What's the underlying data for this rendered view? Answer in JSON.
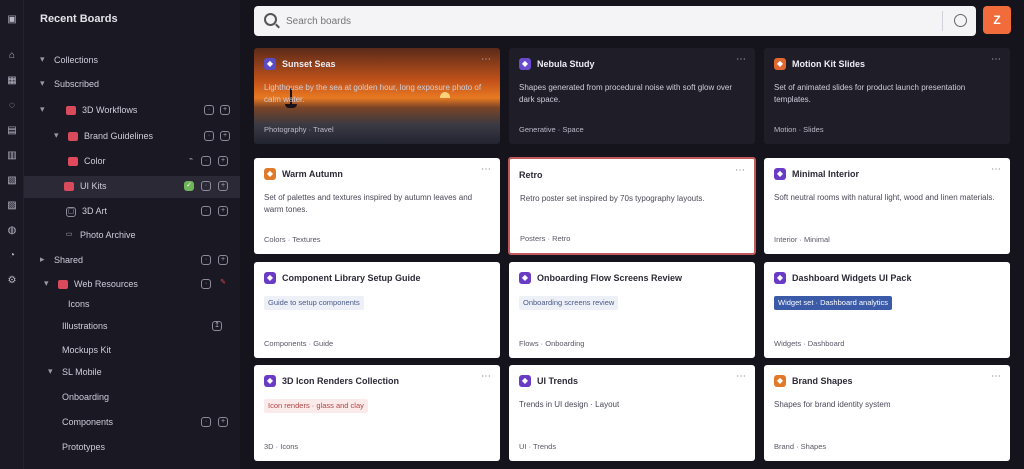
{
  "sidebar": {
    "title": "Recent Boards",
    "rows": [
      {
        "label": "Collections",
        "chev": "▾"
      },
      {
        "label": "Subscribed",
        "chev": "▾"
      },
      {
        "label": "3D Workflows",
        "chev": "▾"
      },
      {
        "label": "Brand Guidelines",
        "chev": "▾"
      },
      {
        "label": "Color",
        "chev": ""
      },
      {
        "label": "UI Kits",
        "chev": ""
      },
      {
        "label": "3D Art",
        "chev": ""
      },
      {
        "label": "Photo Archive",
        "chev": ""
      },
      {
        "label": "Shared",
        "chev": "▸"
      },
      {
        "label": "Web Resources",
        "chev": "▾"
      },
      {
        "label": "Icons",
        "chev": ""
      },
      {
        "label": "Illustrations",
        "chev": ""
      },
      {
        "label": "Mockups Kit",
        "chev": ""
      },
      {
        "label": "SL Mobile",
        "chev": "▾"
      },
      {
        "label": "Onboarding",
        "chev": ""
      },
      {
        "label": "Components",
        "chev": ""
      },
      {
        "label": "Prototypes",
        "chev": ""
      }
    ]
  },
  "search": {
    "placeholder": "Search boards"
  },
  "profile": {
    "label": "Z"
  },
  "cards": [
    {
      "title": "Sunset Seas",
      "desc": "Lighthouse by the sea at golden hour, long exposure photo of calm water.",
      "meta": "Photography · Travel",
      "badge": "◆",
      "badge_color": "#5b4bc4"
    },
    {
      "title": "Nebula Study",
      "desc": "Shapes generated from procedural noise with soft glow over dark space.",
      "meta": "Generative · Space",
      "badge": "◆",
      "badge_color": "#6a4bd0"
    },
    {
      "title": "Motion Kit Slides",
      "desc": "Set of animated slides for product launch presentation templates.",
      "meta": "Motion · Slides",
      "badge": "◆",
      "badge_color": "#e0672f"
    },
    {
      "title": "Warm Autumn",
      "desc": "Set of palettes and textures inspired by autumn leaves and warm tones.",
      "meta": "Colors · Textures",
      "badge": "◆",
      "badge_color": "#e07a2a"
    },
    {
      "title": "Retro",
      "desc": "Retro poster set inspired by 70s typography layouts.",
      "meta": "Posters · Retro",
      "badge": "◆",
      "badge_color": "#444"
    },
    {
      "title": "Minimal Interior",
      "desc": "Soft neutral rooms with natural light, wood and linen materials.",
      "meta": "Interior · Minimal",
      "badge": "◆",
      "badge_color": "#6a3bc4"
    },
    {
      "title": "Component Library Setup Guide",
      "desc": "Guide to setup components",
      "meta": "Components · Guide",
      "badge": "◆",
      "badge_color": "#6a3bc4"
    },
    {
      "title": "Onboarding Flow Screens Review",
      "desc": "Onboarding screens review",
      "meta": "Flows · Onboarding",
      "badge": "◆",
      "badge_color": "#6a3bc4"
    },
    {
      "title": "Dashboard Widgets UI Pack",
      "desc": "Widget set · Dashboard analytics",
      "meta": "Widgets · Dashboard",
      "badge": "◆",
      "badge_color": "#6a3bc4"
    },
    {
      "title": "3D Icon Renders Collection",
      "desc": "Icon renders · glass and clay",
      "meta": "3D · Icons",
      "badge": "◆",
      "badge_color": "#6a3bc4"
    },
    {
      "title": "UI Trends",
      "desc": "Trends in UI design · Layout",
      "meta": "UI · Trends",
      "badge": "◆",
      "badge_color": "#6a3bc4"
    },
    {
      "title": "Brand Shapes",
      "desc": "Shapes for brand identity system",
      "meta": "Brand · Shapes",
      "badge": "◆",
      "badge_color": "#e07a2a"
    }
  ]
}
